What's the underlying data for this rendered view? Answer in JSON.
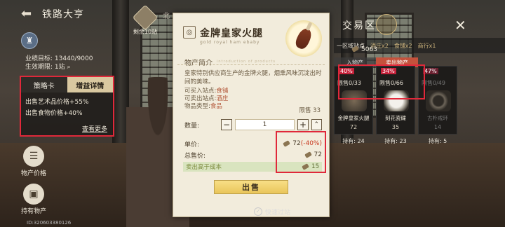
{
  "header": {
    "title": "铁路大亨",
    "fragment": "北"
  },
  "stats": {
    "target": "业绩目标: 13440/9000",
    "validity": "生效期限: 1站"
  },
  "strategy": {
    "tab_card": "策略卡",
    "tab_detail": "增益详情",
    "effects": [
      "出售艺术品价格+55%",
      "出售食物价格+40%"
    ],
    "more": "查看更多"
  },
  "side_buttons": {
    "prices": "物产价格",
    "holdings": "持有物产"
  },
  "remaining": {
    "label": "剩余10站"
  },
  "uid": "ID:320603380126",
  "dialog": {
    "item_name": "金牌皇家火腿",
    "item_sub": "gold royal ham ebaby",
    "section_title": "物产简介",
    "section_en": "introduction of products",
    "description": "皇家特别供应商生产的金牌火腿，烟熏风味沉淀出时间的美味。",
    "buy_station_label": "可买入站点:",
    "buy_station": "食铺",
    "sell_station_label": "可卖出站点:",
    "sell_station": "酒庄",
    "type_label": "物品类型:",
    "type": "食品",
    "limit": "限售 33",
    "qty_label": "数量:",
    "qty_value": "1",
    "unit_price_label": "单价:",
    "unit_price": "72",
    "unit_discount": "(-40%)",
    "total_label": "总售价:",
    "total_price": "72",
    "profit_label": "卖出高于成本",
    "profit_value": "15",
    "sell_button": "出售",
    "quick_label": "快速过站"
  },
  "trade": {
    "title": "交易区",
    "bar": [
      "一区域站点",
      "酒庄x2",
      "食铺x2",
      "商行x1"
    ],
    "money": "5063",
    "tab_left": "入物产",
    "tab_right": "卖出物产",
    "cards": [
      {
        "pct": "40%",
        "limit": "限售0/33",
        "name": "金牌皇家火腿",
        "price": "72",
        "hold": "持有: 24"
      },
      {
        "pct": "34%",
        "limit": "限售0/66",
        "name": "刻花瓷碟",
        "price": "35",
        "hold": "持有: 23"
      },
      {
        "pct": "47%",
        "limit": "限售0/49",
        "name": "古朴戒环",
        "price": "14",
        "hold": "持有: 5"
      }
    ]
  },
  "colors": {
    "highlight": "#e0283a",
    "accent": "#e9c55a",
    "discount": "#c5213a"
  }
}
